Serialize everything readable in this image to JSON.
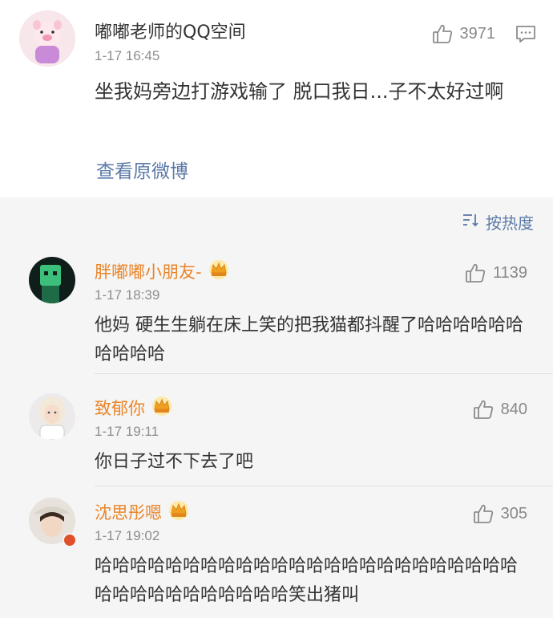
{
  "post": {
    "author": "嘟嘟老师的QQ空间",
    "time": "1-17 16:45",
    "likes": "3971",
    "content": "坐我妈旁边打游戏输了 脱口我日...子不太好过啊",
    "view_original": "查看原微博"
  },
  "sort": {
    "label": "按热度"
  },
  "comments": [
    {
      "author": "胖嘟嘟小朋友-",
      "time": "1-17 18:39",
      "likes": "1139",
      "content": "他妈 硬生生躺在床上笑的把我猫都抖醒了哈哈哈哈哈哈哈哈哈哈"
    },
    {
      "author": "致郁你",
      "time": "1-17 19:11",
      "likes": "840",
      "content": "你日子过不下去了吧"
    },
    {
      "author": "沈思彤嗯",
      "time": "1-17 19:02",
      "likes": "305",
      "content": "哈哈哈哈哈哈哈哈哈哈哈哈哈哈哈哈哈哈哈哈哈哈哈哈哈哈哈哈哈哈哈哈哈哈哈笑出猪叫"
    }
  ],
  "colors": {
    "link": "#5b7aa8",
    "vip_name": "#e9852a",
    "crown": "#f0b429"
  },
  "icons": {
    "like": "thumbs-up-icon",
    "comment": "comment-bubble-icon",
    "sort": "sort-lines-icon",
    "crown": "vip-crown-icon"
  }
}
